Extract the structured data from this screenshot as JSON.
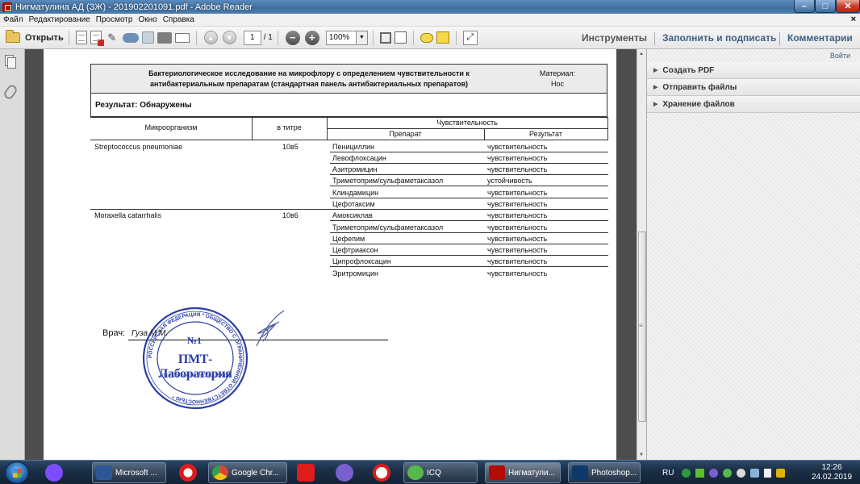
{
  "window": {
    "title": "Нигматулина АД (ЗЖ) - 201902201091.pdf - Adobe Reader",
    "controls": {
      "minimize": "–",
      "maximize": "□",
      "close": "✕"
    }
  },
  "menu": {
    "items": [
      "Файл",
      "Редактирование",
      "Просмотр",
      "Окно",
      "Справка"
    ],
    "close": "×"
  },
  "toolbar": {
    "open_label": "Открыть",
    "page_current": "1",
    "page_total": "/ 1",
    "zoom": "100%",
    "tools_label": "Инструменты",
    "fill_sign_label": "Заполнить и подписать",
    "comments_label": "Комментарии",
    "icons": [
      "create-pdf-icon",
      "edit-pdf-icon",
      "sign-icon",
      "upload-icon",
      "save-icon",
      "print-icon",
      "email-icon",
      "prev-page-icon",
      "next-page-icon",
      "zoom-out-icon",
      "zoom-in-icon",
      "fit-width-icon",
      "fit-page-icon",
      "comment-icon",
      "highlight-icon",
      "expand-icon"
    ]
  },
  "right_panel": {
    "login": "Войти",
    "items": [
      "Создать PDF",
      "Отправить файлы",
      "Хранение файлов"
    ]
  },
  "report": {
    "title_line1": "Бактериологическое исследование на микрофлору с определением чувствительности к",
    "title_line2": "антибактериальным препаратам (стандартная панель антибактериальных препаратов)",
    "material_label": "Материал:",
    "material_value": "Нос",
    "result_label": "Результат: Обнаружены",
    "headers": {
      "organism": "Микроорганизм",
      "titer": "в титре",
      "sensitivity": "Чувствительность",
      "drug": "Препарат",
      "result": "Результат"
    },
    "organisms": [
      {
        "name": "Streptococcus pneumoniae",
        "titer": "10в5",
        "rows": [
          {
            "drug": "Пенициллин",
            "result": "чувствительность"
          },
          {
            "drug": "Левофлоксацин",
            "result": "чувствительность"
          },
          {
            "drug": "Азитромицин",
            "result": "чувствительность"
          },
          {
            "drug": "Триметоприм/сульфаметаксазол",
            "result": "устойчивость"
          },
          {
            "drug": "Клиндамицин",
            "result": "чувствительность"
          },
          {
            "drug": "Цефотаксим",
            "result": "чувствительность"
          }
        ]
      },
      {
        "name": "Moraxella catarrhalis",
        "titer": "10в6",
        "rows": [
          {
            "drug": "Амоксиклав",
            "result": "чувствительность"
          },
          {
            "drug": "Триметоприм/сульфаметаксазол",
            "result": "чувствительность"
          },
          {
            "drug": "Цефепим",
            "result": "чувствительность"
          },
          {
            "drug": "Цефтриаксон",
            "result": "чувствительность"
          },
          {
            "drug": "Ципрофлоксацин",
            "result": "чувствительность"
          },
          {
            "drug": "Эритромицин",
            "result": "чувствительность"
          }
        ]
      }
    ],
    "doctor_label": "Врач:",
    "doctor_name": "Гуза М.М.",
    "stamp": {
      "number": "№1",
      "name": "ПМТ-Лаборатория",
      "ring_text": "РОССИЙСКАЯ ФЕДЕРАЦИЯ * ОБЩЕСТВО С ОГРАНИЧЕННОЙ ОТВЕТСТВЕННОСТЬЮ *",
      "sub_text": "ДЛЯ РЕЗУЛЬТАТОВ ИССЛЕДОВАНИЙ",
      "color": "#2b3fa6"
    }
  },
  "taskbar": {
    "buttons": [
      {
        "label": "Microsoft ...",
        "icon": "word-icon",
        "color": "#2b5797"
      },
      {
        "label": "Google Chr...",
        "icon": "chrome-icon",
        "color": "#e0a81e"
      },
      {
        "label": "ICQ",
        "icon": "icq-icon",
        "color": "#59b84b"
      },
      {
        "label": "Нигматули...",
        "icon": "adobe-reader-icon",
        "color": "#b30b00"
      },
      {
        "label": "Photoshop...",
        "icon": "photoshop-icon",
        "color": "#0b3a6b"
      }
    ],
    "lang": "RU",
    "time": "12:26",
    "date": "24.02.2019"
  },
  "colors": {
    "accent_blue": "#3b5f86",
    "stamp_blue": "#2b3fa6",
    "doc_background": "#4d4d4d"
  }
}
